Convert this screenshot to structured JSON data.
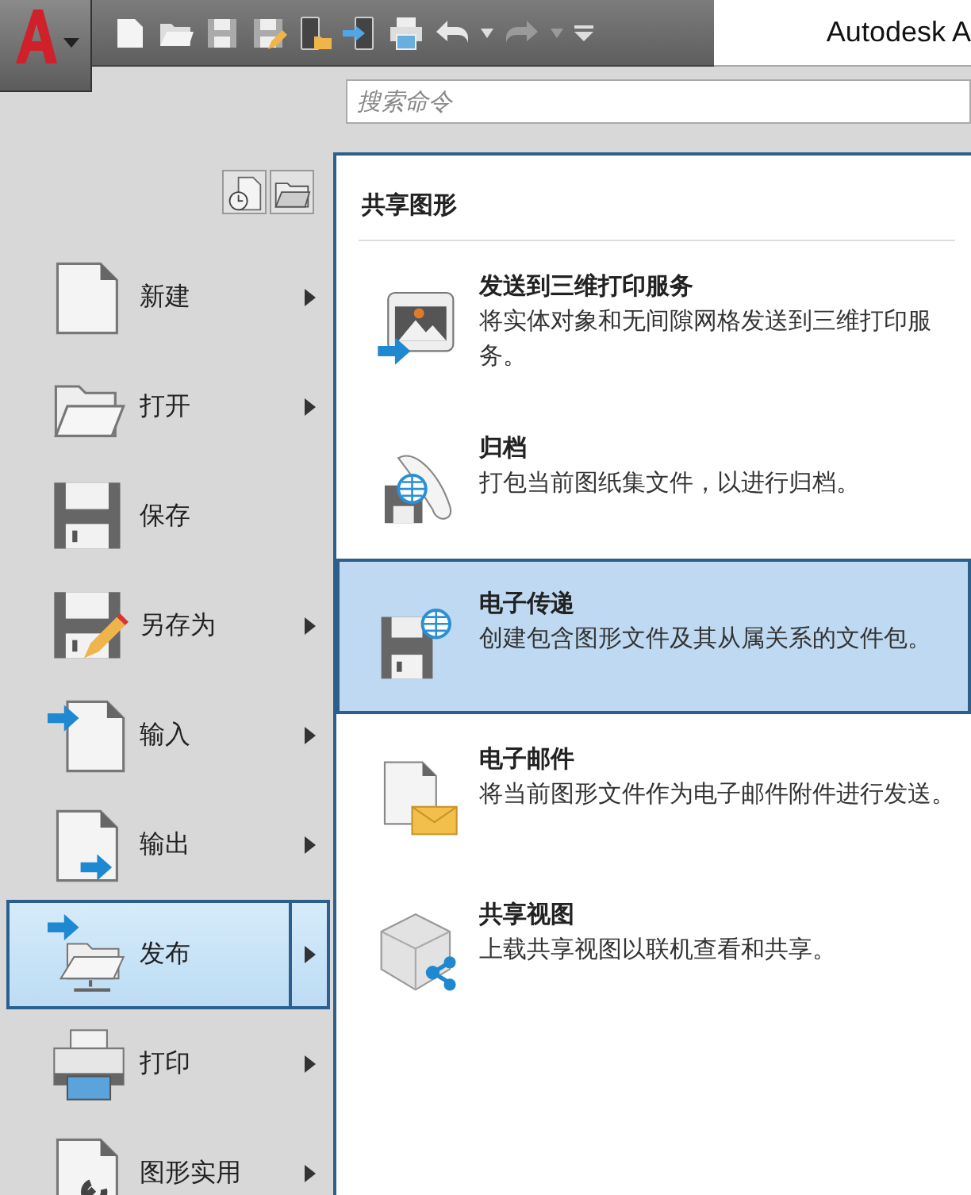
{
  "title_bar": {
    "title": "Autodesk A"
  },
  "quick_access_toolbar": {
    "undo_enabled": true,
    "redo_enabled": false
  },
  "search": {
    "placeholder": "搜索命令"
  },
  "menu": [
    {
      "label": "新建",
      "has_submenu": true,
      "selected": false
    },
    {
      "label": "打开",
      "has_submenu": true,
      "selected": false
    },
    {
      "label": "保存",
      "has_submenu": false,
      "selected": false
    },
    {
      "label": "另存为",
      "has_submenu": true,
      "selected": false
    },
    {
      "label": "输入",
      "has_submenu": true,
      "selected": false
    },
    {
      "label": "输出",
      "has_submenu": true,
      "selected": false
    },
    {
      "label": "发布",
      "has_submenu": true,
      "selected": true
    },
    {
      "label": "打印",
      "has_submenu": true,
      "selected": false
    },
    {
      "label": "图形实用",
      "has_submenu": true,
      "selected": false
    }
  ],
  "submenu": {
    "title": "共享图形",
    "items": [
      {
        "title": "发送到三维打印服务",
        "description": "将实体对象和无间隙网格发送到三维打印服务。",
        "selected": false
      },
      {
        "title": "归档",
        "description": "打包当前图纸集文件，以进行归档。",
        "selected": false
      },
      {
        "title": "电子传递",
        "description": "创建包含图形文件及其从属关系的文件包。",
        "selected": true
      },
      {
        "title": "电子邮件",
        "description": "将当前图形文件作为电子邮件附件进行发送。",
        "selected": false
      },
      {
        "title": "共享视图",
        "description": "上载共享视图以联机查看和共享。",
        "selected": false
      }
    ]
  }
}
